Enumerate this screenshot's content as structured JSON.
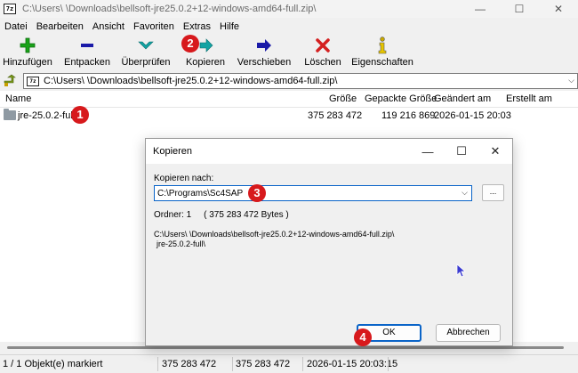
{
  "window": {
    "title": "C:\\Users\\      \\Downloads\\bellsoft-jre25.0.2+12-windows-amd64-full.zip\\",
    "minimize": "—",
    "maximize": "☐",
    "close": "✕"
  },
  "menu": [
    "Datei",
    "Bearbeiten",
    "Ansicht",
    "Favoriten",
    "Extras",
    "Hilfe"
  ],
  "toolbar": {
    "add": "Hinzufügen",
    "extract": "Entpacken",
    "test": "Überprüfen",
    "copy": "Kopieren",
    "move": "Verschieben",
    "delete": "Löschen",
    "info": "Eigenschaften"
  },
  "address": {
    "path": "C:\\Users\\      \\Downloads\\bellsoft-jre25.0.2+12-windows-amd64-full.zip\\"
  },
  "columns": {
    "name": "Name",
    "size": "Größe",
    "packed": "Gepackte Größe",
    "modified": "Geändert am",
    "created": "Erstellt am"
  },
  "rows": [
    {
      "name": "jre-25.0.2-full",
      "size": "375 283 472",
      "packed": "119 216 869",
      "modified": "2026-01-15 20:03",
      "created": ""
    }
  ],
  "status": {
    "selected": "1 / 1 Objekt(e) markiert",
    "size": "375 283 472",
    "packed": "375 283 472",
    "date": "2026-01-15 20:03:15"
  },
  "dialog": {
    "title": "Kopieren",
    "minimize": "—",
    "maximize": "☐",
    "close": "✕",
    "label": "Kopieren nach:",
    "target": "C:\\Programs\\Sc4SAP",
    "browse": "...",
    "info": "Ordner: 1     ( 375 283 472 Bytes )",
    "path_line1": "C:\\Users\\      \\Downloads\\bellsoft-jre25.0.2+12-windows-amd64-full.zip\\",
    "path_line2": "jre-25.0.2-full\\",
    "ok": "OK",
    "cancel": "Abbrechen"
  },
  "markers": [
    "1",
    "2",
    "3",
    "4"
  ],
  "colors": {
    "marker": "#d7191c",
    "focus": "#0a64c8",
    "add_icon": "#1aa31a",
    "extract_icon": "#1a1aa8",
    "test_icon": "#12a3a3",
    "copy_icon": "#12a3a3",
    "move_icon": "#1a1aa8",
    "delete_icon": "#d42020",
    "info_icon": "#c8a800"
  }
}
